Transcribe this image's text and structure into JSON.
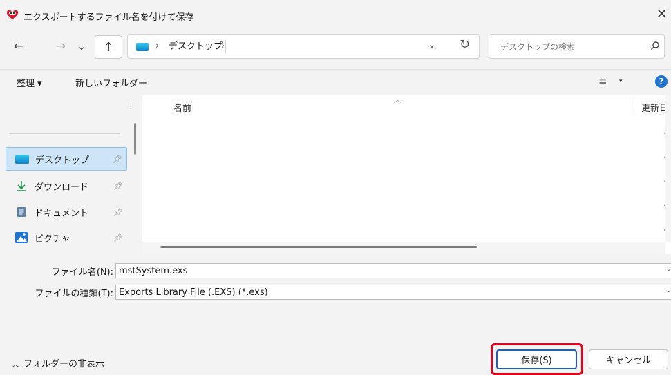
{
  "window": {
    "title": "エクスポートするファイル名を付けて保存"
  },
  "nav": {
    "back": "←",
    "forward": "→",
    "recent": "⌄",
    "up": "↑",
    "address": {
      "segments": [
        "デスクトップ"
      ]
    },
    "search_placeholder": "デスクトップの検索"
  },
  "toolbar": {
    "organize": "整理 ▾",
    "new_folder": "新しいフォルダー",
    "view_icon": "≡",
    "view_dropdown": "▾",
    "help": "?"
  },
  "sidebar": {
    "items": [
      {
        "label": "デスクトップ",
        "icon": "desktop-icon",
        "selected": true
      },
      {
        "label": "ダウンロード",
        "icon": "download-icon"
      },
      {
        "label": "ドキュメント",
        "icon": "document-icon"
      },
      {
        "label": "ピクチャ",
        "icon": "pictures-icon"
      }
    ]
  },
  "content": {
    "columns": [
      "名前",
      "更新日"
    ]
  },
  "form": {
    "filename_label": "ファイル名(N):",
    "filename_value": "mstSystem.exs",
    "filetype_label": "ファイルの種類(T):",
    "filetype_value": "Exports Library File (.EXS) (*.exs)"
  },
  "footer": {
    "hide_folders": "フォルダーの非表示",
    "save": "保存(S)",
    "cancel": "キャンセル"
  },
  "colors": {
    "accent": "#1e74d2",
    "highlight": "#e6001a",
    "selection": "#cde5f7"
  }
}
